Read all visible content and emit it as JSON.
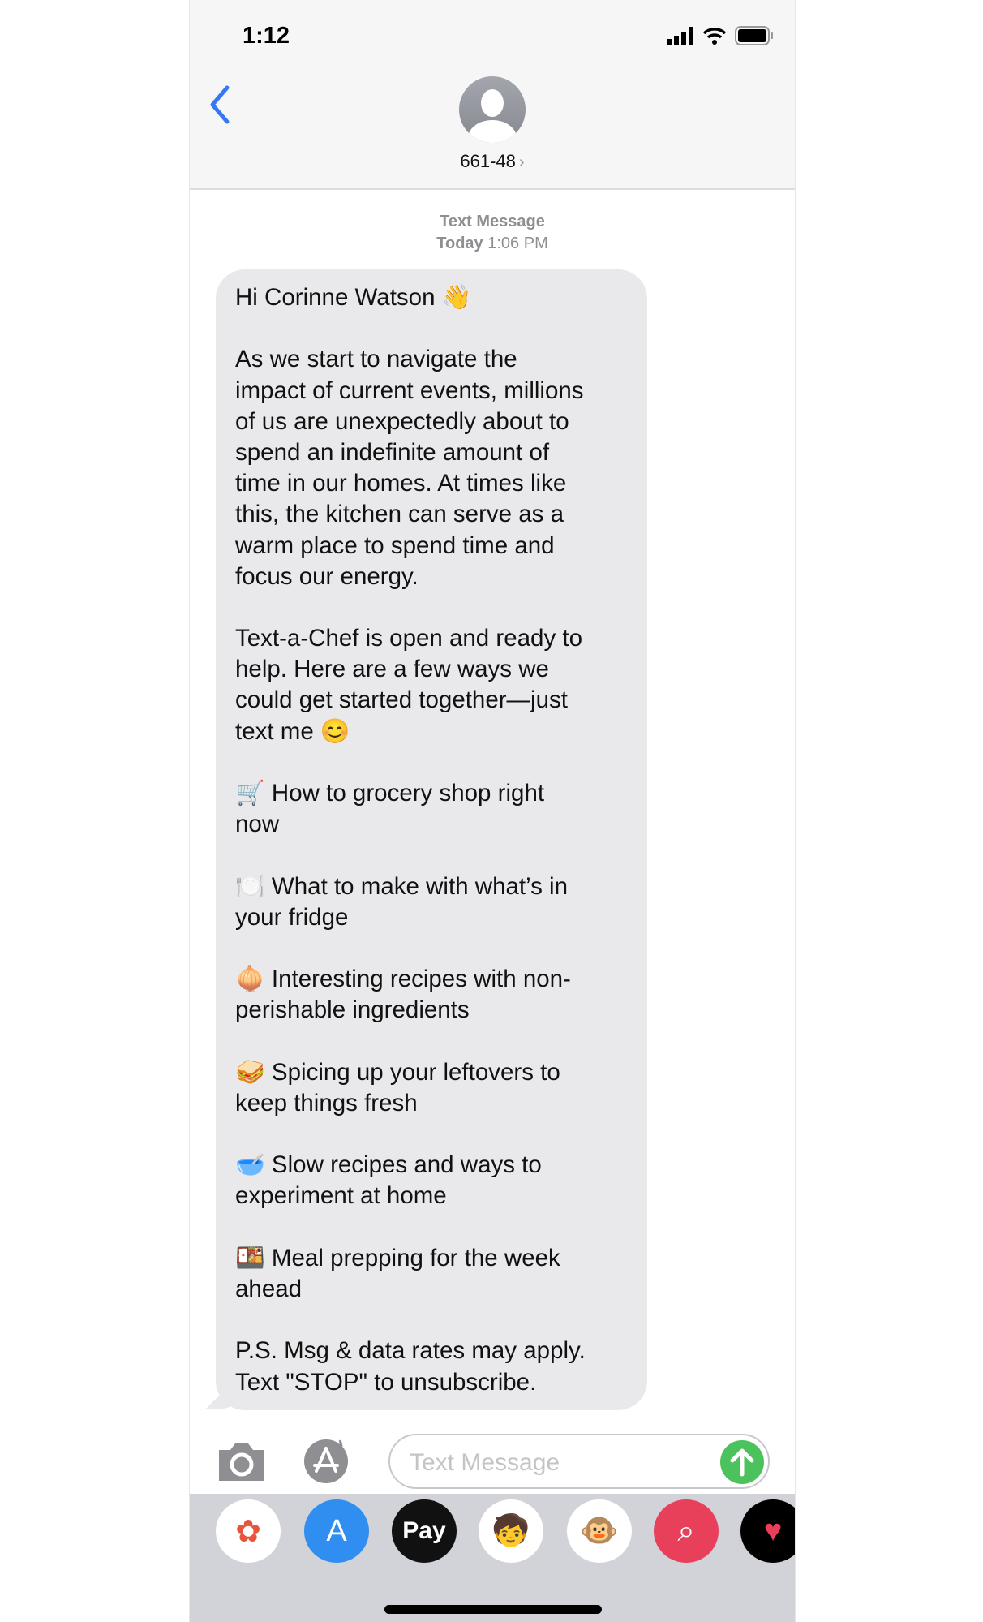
{
  "status_bar": {
    "time": "1:12"
  },
  "header": {
    "contact": "661-48",
    "contact_chevron": "›"
  },
  "meta": {
    "service": "Text Message",
    "day": "Today",
    "time": "1:06 PM"
  },
  "message": {
    "lines": [
      "Hi Corinne Watson 👋",
      "",
      "As we start to navigate the",
      "impact of current events, millions",
      "of us are unexpectedly about to",
      "spend an indefinite amount of",
      "time in our homes. At times like",
      "this, the kitchen can serve as a",
      "warm place to spend time and",
      "focus our energy.",
      "",
      "Text-a-Chef is open and ready to",
      "help. Here are a few ways we",
      "could get started together—just",
      "text me 😊",
      "",
      "🛒 How to grocery shop right",
      "now",
      "",
      "🍽️ What to make with what’s in",
      "your fridge",
      "",
      "🧅 Interesting recipes with non-",
      "perishable ingredients",
      "",
      "🥪 Spicing up your leftovers to",
      "keep things fresh",
      "",
      "🥣 Slow recipes and ways to",
      "experiment at home",
      "",
      "🍱 Meal prepping for the week",
      "ahead",
      "",
      "P.S. Msg & data rates may apply.",
      "Text \"STOP\" to unsubscribe."
    ]
  },
  "composer": {
    "placeholder": "Text Message"
  },
  "drawer": {
    "apps": [
      {
        "name": "photos",
        "glyph": "✿",
        "bg": "#ffffff",
        "fg": "#e8553f"
      },
      {
        "name": "app-store",
        "glyph": "A",
        "bg": "#2f8ef0",
        "fg": "#ffffff"
      },
      {
        "name": "apple-pay",
        "glyph": "Pay",
        "bg": "#111111",
        "fg": "#ffffff"
      },
      {
        "name": "memoji",
        "glyph": "🧒",
        "bg": "#ffffff",
        "fg": "#000000"
      },
      {
        "name": "animoji",
        "glyph": "🐵",
        "bg": "#ffffff",
        "fg": "#000000"
      },
      {
        "name": "search-images",
        "glyph": "⌕",
        "bg": "#e8405a",
        "fg": "#ffffff"
      },
      {
        "name": "digital-touch",
        "glyph": "♥",
        "bg": "#000000",
        "fg": "#e8405a"
      }
    ]
  },
  "colors": {
    "accent": "#3478f6",
    "bubble": "#e9e9eb",
    "send": "#4cc25d",
    "drawer": "#d2d3d8"
  }
}
